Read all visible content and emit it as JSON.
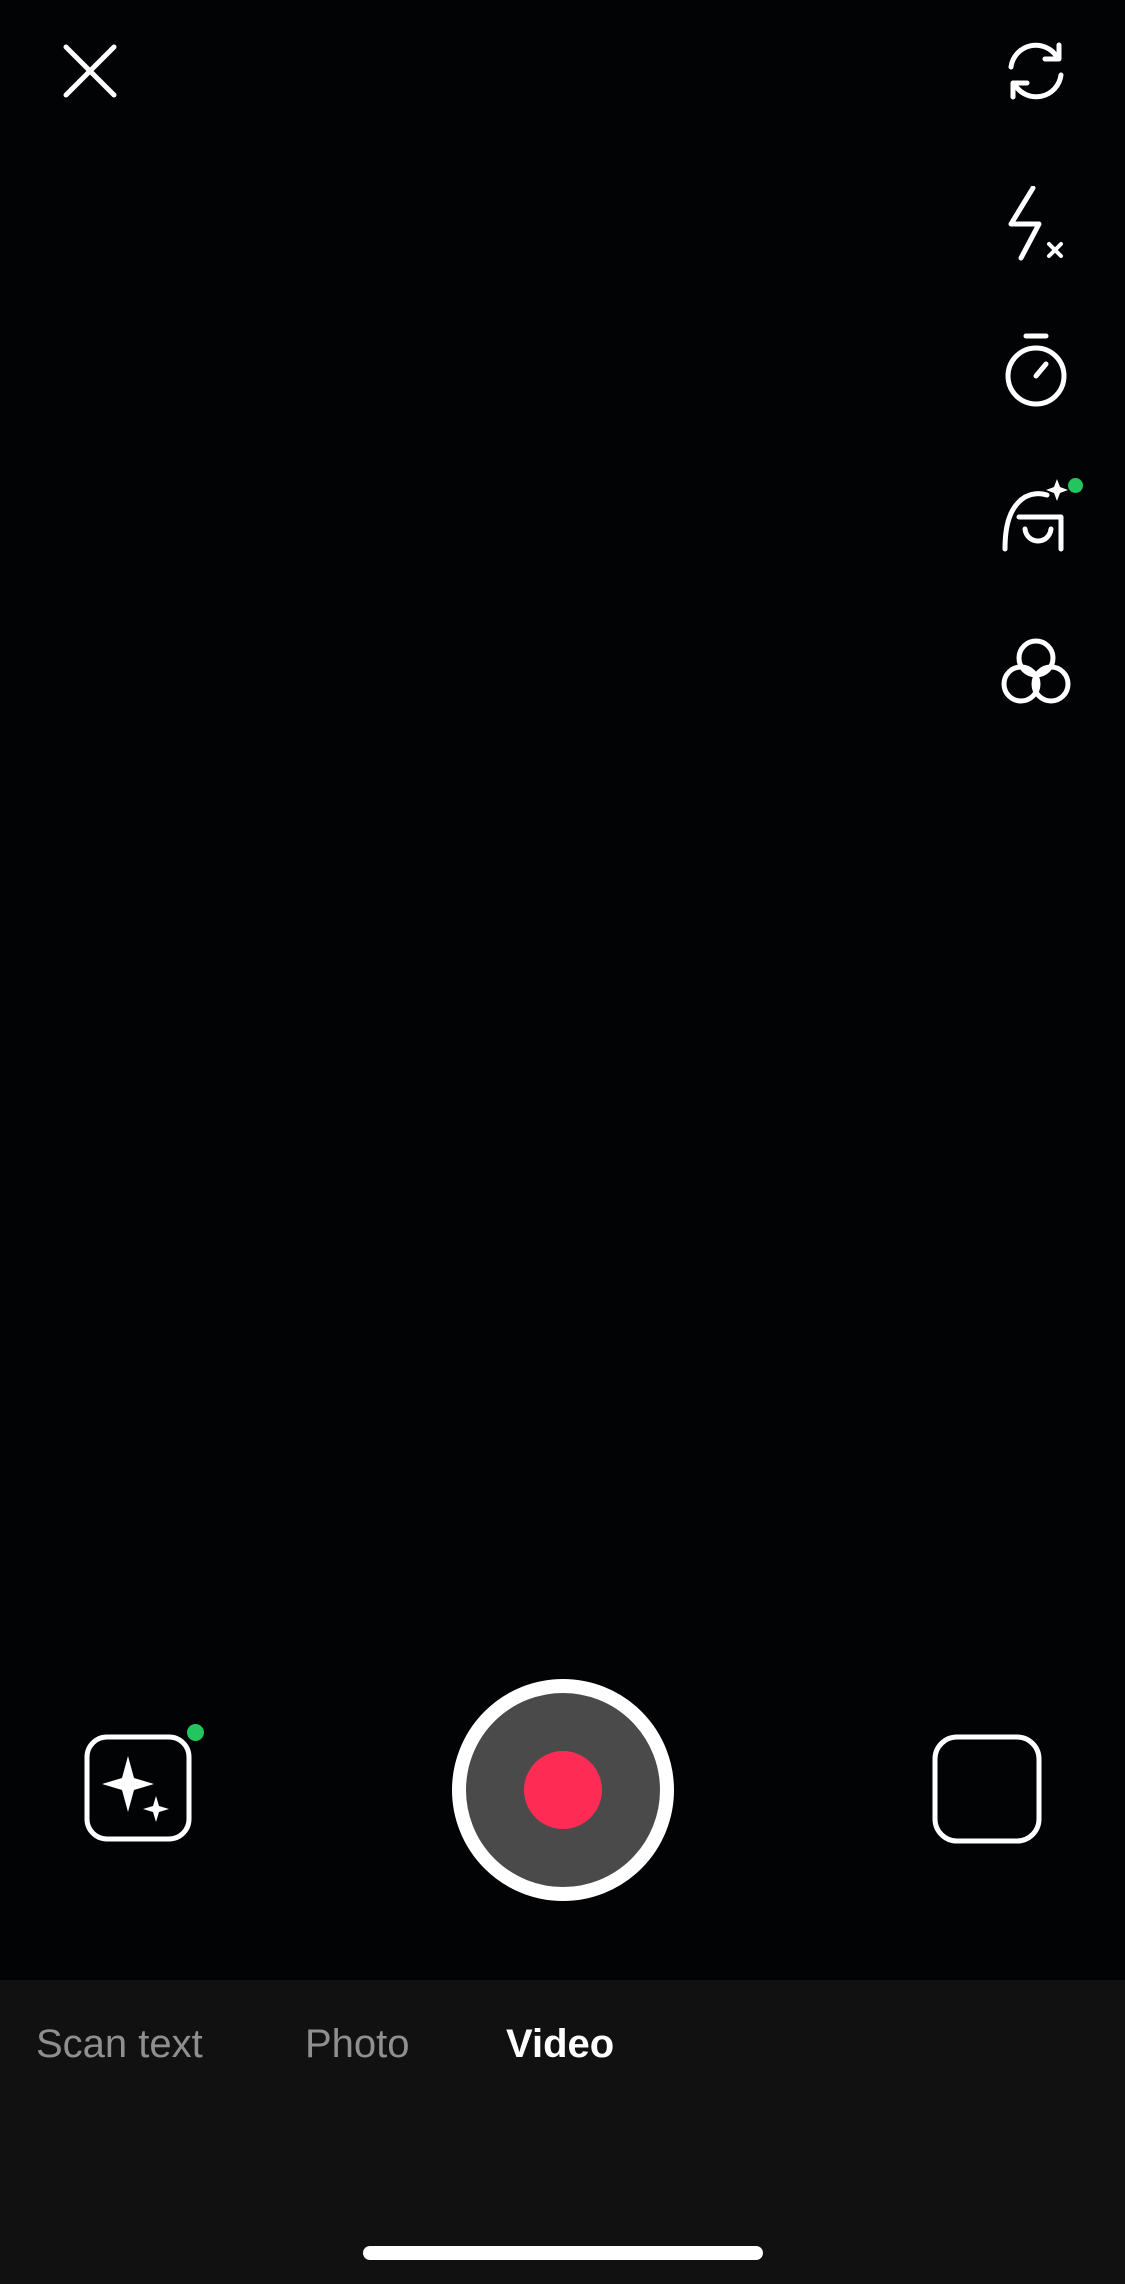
{
  "top_controls": {
    "close_icon": "close-icon",
    "right_rail": [
      {
        "name": "flip-camera",
        "icon": "flip-camera-icon"
      },
      {
        "name": "flash-off",
        "icon": "flash-off-icon"
      },
      {
        "name": "timer",
        "icon": "timer-icon"
      },
      {
        "name": "beauty",
        "icon": "beauty-icon",
        "has_dot": true
      },
      {
        "name": "filters",
        "icon": "filters-icon"
      }
    ]
  },
  "capture": {
    "effects_icon": "sparkles-icon",
    "effects_has_dot": true,
    "record_icon": "record-button",
    "gallery_icon": "gallery-icon"
  },
  "modes": {
    "items": [
      "Scan text",
      "Photo",
      "Video"
    ],
    "active": "Video"
  },
  "colors": {
    "accent_dot": "#22c55e",
    "record_red": "#fe2c55",
    "record_inner": "#4a4a4a",
    "inactive_mode": "#8f8f8f"
  }
}
